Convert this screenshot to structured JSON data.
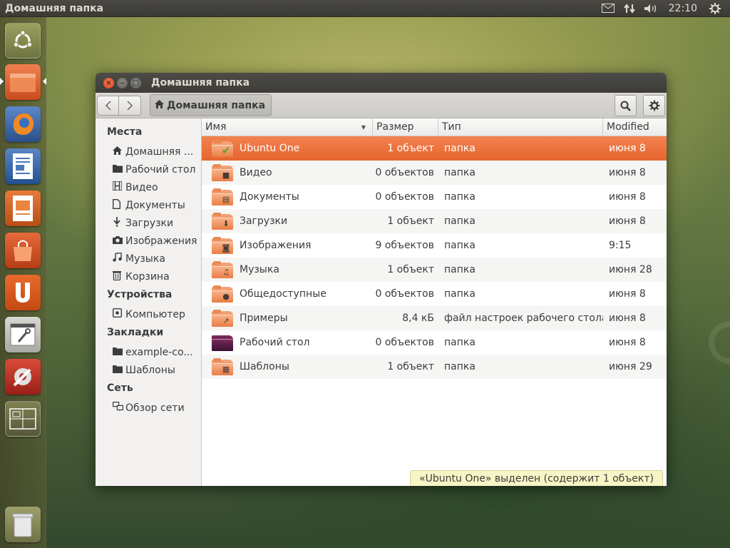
{
  "top_panel": {
    "title": "Домашняя папка",
    "clock": "22:10"
  },
  "window": {
    "title": "Домашняя папка",
    "path_button": "Домашняя папка"
  },
  "sidebar": {
    "sections": [
      {
        "heading": "Места",
        "items": [
          {
            "label": "Домашняя ...",
            "icon": "home-icon"
          },
          {
            "label": "Рабочий стол",
            "icon": "folder-icon"
          },
          {
            "label": "Видео",
            "icon": "film-icon"
          },
          {
            "label": "Документы",
            "icon": "document-icon"
          },
          {
            "label": "Загрузки",
            "icon": "download-icon"
          },
          {
            "label": "Изображения",
            "icon": "camera-icon"
          },
          {
            "label": "Музыка",
            "icon": "music-icon"
          },
          {
            "label": "Корзина",
            "icon": "trash-icon"
          }
        ]
      },
      {
        "heading": "Устройства",
        "items": [
          {
            "label": "Компьютер",
            "icon": "drive-icon"
          }
        ]
      },
      {
        "heading": "Закладки",
        "items": [
          {
            "label": "example-co...",
            "icon": "folder-icon"
          },
          {
            "label": "Шаблоны",
            "icon": "folder-icon"
          }
        ]
      },
      {
        "heading": "Сеть",
        "items": [
          {
            "label": "Обзор сети",
            "icon": "network-icon"
          }
        ]
      }
    ]
  },
  "list": {
    "columns": {
      "name": "Имя",
      "size": "Размер",
      "type": "Тип",
      "modified": "Modified"
    },
    "rows": [
      {
        "name": "Ubuntu One",
        "size": "1 объект",
        "type": "папка",
        "modified": "июня 8",
        "icon": "ubuntu-one-folder-icon"
      },
      {
        "name": "Видео",
        "size": "0 объектов",
        "type": "папка",
        "modified": "июня 8",
        "icon": "video-folder-icon"
      },
      {
        "name": "Документы",
        "size": "0 объектов",
        "type": "папка",
        "modified": "июня 8",
        "icon": "documents-folder-icon"
      },
      {
        "name": "Загрузки",
        "size": "1 объект",
        "type": "папка",
        "modified": "июня 8",
        "icon": "downloads-folder-icon"
      },
      {
        "name": "Изображения",
        "size": "9 объектов",
        "type": "папка",
        "modified": "9:15",
        "icon": "pictures-folder-icon"
      },
      {
        "name": "Музыка",
        "size": "1 объект",
        "type": "папка",
        "modified": "июня 28",
        "icon": "music-folder-icon"
      },
      {
        "name": "Общедоступные",
        "size": "0 объектов",
        "type": "папка",
        "modified": "июня 8",
        "icon": "public-folder-icon"
      },
      {
        "name": "Примеры",
        "size": "8,4 кБ",
        "type": "файл настроек рабочего стола",
        "modified": "июня 8",
        "icon": "examples-folder-icon"
      },
      {
        "name": "Рабочий стол",
        "size": "0 объектов",
        "type": "папка",
        "modified": "июня 8",
        "icon": "desktop-folder-icon"
      },
      {
        "name": "Шаблоны",
        "size": "1 объект",
        "type": "папка",
        "modified": "июня 29",
        "icon": "templates-folder-icon"
      }
    ]
  },
  "status": "«Ubuntu One» выделен (содержит 1 объект)",
  "colors": {
    "selection": "#e9692f",
    "accent": "#dd4814"
  }
}
